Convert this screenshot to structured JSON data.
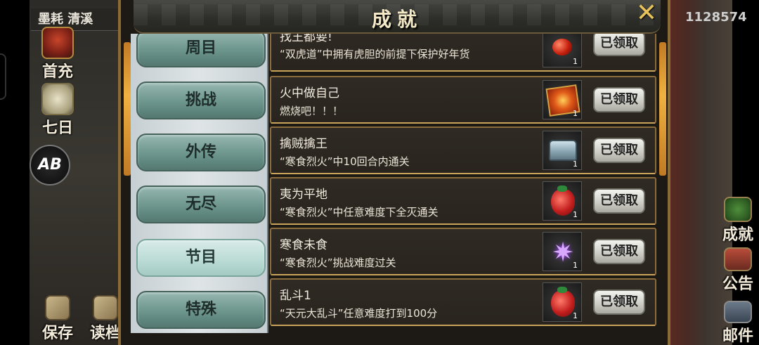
{
  "hud": {
    "player": "墨耗 清溪",
    "coins": "1128574"
  },
  "left_buttons": [
    {
      "label": "首充",
      "icon": "gift-icon"
    },
    {
      "label": "七日",
      "icon": "seven-day-icon"
    },
    {
      "label": "保存",
      "icon": "save-icon"
    },
    {
      "label": "读档",
      "icon": "load-icon"
    }
  ],
  "ab_badge": "AB",
  "right_buttons": [
    {
      "label": "成就",
      "icon": "achievement-icon"
    },
    {
      "label": "公告",
      "icon": "notice-icon"
    },
    {
      "label": "邮件",
      "icon": "mail-icon"
    }
  ],
  "panel": {
    "title": "成就",
    "close": "✕"
  },
  "tabs": [
    {
      "label": "周目",
      "active": false
    },
    {
      "label": "挑战",
      "active": false
    },
    {
      "label": "外传",
      "active": false
    },
    {
      "label": "无尽",
      "active": false
    },
    {
      "label": "节目",
      "active": true
    },
    {
      "label": "特殊",
      "active": false
    }
  ],
  "achievements": [
    {
      "title": "找王都要!",
      "desc": "“双虎道”中拥有虎胆的前提下保护好年货",
      "item": "red-gem-icon",
      "qty": "1",
      "button": "已领取"
    },
    {
      "title": "火中做自己",
      "desc": "燃烧吧！！！",
      "item": "fire-book-icon",
      "qty": "1",
      "button": "已领取"
    },
    {
      "title": "擒贼擒王",
      "desc": "“寒食烈火”中10回合内通关",
      "item": "silver-chest-icon",
      "qty": "1",
      "button": "已领取"
    },
    {
      "title": "夷为平地",
      "desc": "“寒食烈火”中任意难度下全灭通关",
      "item": "red-bag-icon",
      "qty": "1",
      "button": "已领取"
    },
    {
      "title": "寒食未食",
      "desc": "“寒食烈火”挑战难度过关",
      "item": "purple-star-icon",
      "qty": "1",
      "button": "已领取"
    },
    {
      "title": "乱斗1",
      "desc": "“天元大乱斗”任意难度打到100分",
      "item": "red-bag-icon",
      "qty": "1",
      "button": "已领取"
    }
  ]
}
